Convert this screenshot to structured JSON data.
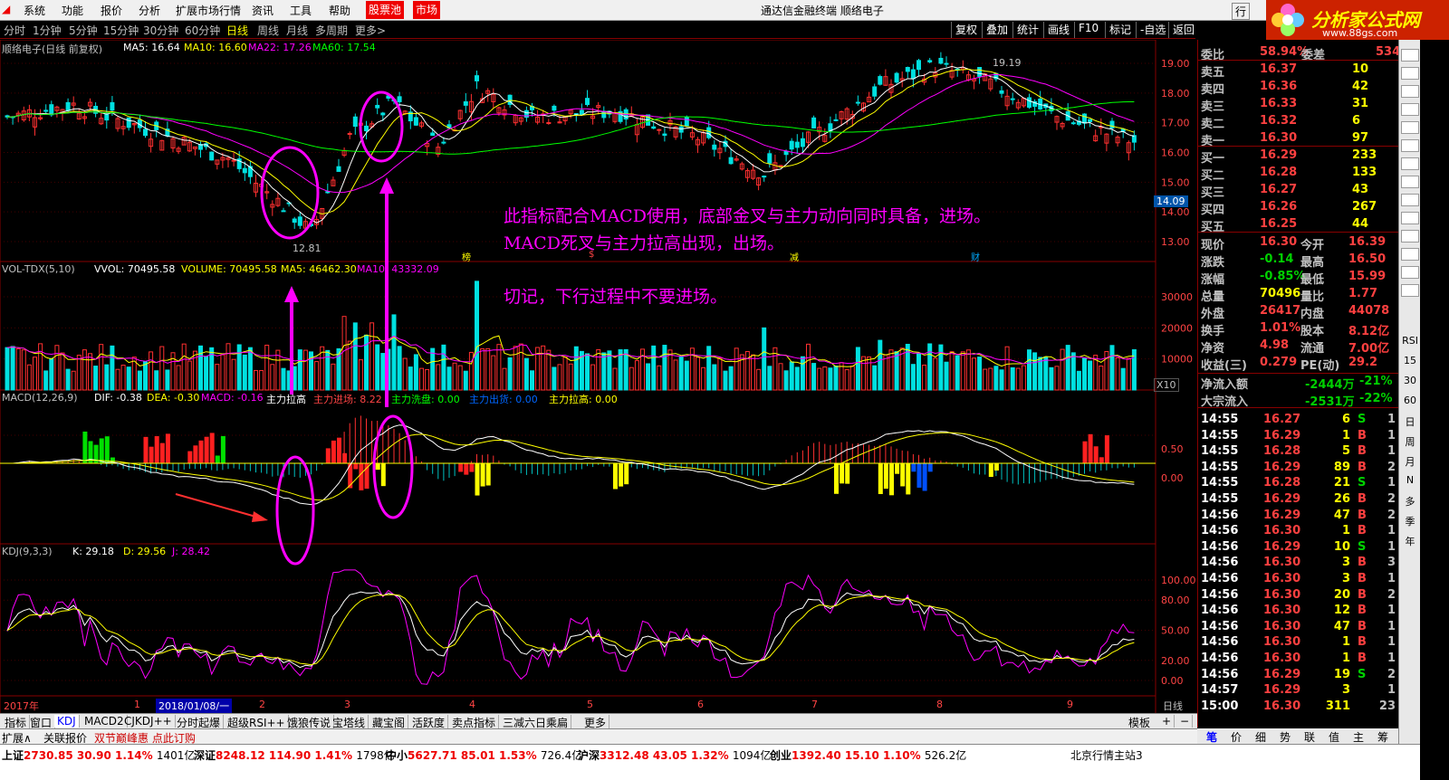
{
  "menu": {
    "items": [
      "系统",
      "功能",
      "报价",
      "分析",
      "扩展市场行情",
      "资讯",
      "工具",
      "帮助"
    ],
    "hot1": "股票池",
    "hot2": "市场",
    "title": "通达信金融终端  顺络电子",
    "logo_text": "分析家公式网",
    "logo_url": "www.88gs.com",
    "right_btn": "行"
  },
  "periods": {
    "items": [
      "分时",
      "1分钟",
      "5分钟",
      "15分钟",
      "30分钟",
      "60分钟",
      "日线",
      "周线",
      "月线",
      "多周期",
      "更多>"
    ],
    "active": "日线",
    "tools": [
      "复权",
      "叠加",
      "统计",
      "画线",
      "F10",
      "标记",
      "-自选",
      "返回"
    ]
  },
  "main_chart": {
    "title": "顺络电子(日线 前复权)",
    "ma": [
      {
        "label": "MA5: 16.64",
        "color": "#ffffff"
      },
      {
        "label": "MA10: 16.60",
        "color": "#ffff00"
      },
      {
        "label": "MA22: 17.26",
        "color": "#ff00ff"
      },
      {
        "label": "MA60: 17.54",
        "color": "#00ff00"
      }
    ],
    "y_ticks": [
      "19.00",
      "18.00",
      "17.00",
      "16.00",
      "15.00",
      "14.00",
      "13.00"
    ],
    "y_values": [
      19,
      18,
      17,
      16,
      15,
      14,
      13
    ],
    "price_tag": "14.09",
    "high_label": "19.19",
    "low_label": "12.81",
    "markers": [
      "榜",
      "$",
      "减",
      "财"
    ],
    "annotation1": "此指标配合MACD使用，底部金叉与主力动向同时具备，进场。",
    "annotation2": "MACD死叉与主力拉高出现，出场。",
    "annotation3": "切记，下行过程中不要进场。"
  },
  "vol_chart": {
    "title": "VOL-TDX(5,10)",
    "vvol": "VVOL: 70495.58",
    "volume": "VOLUME: 70495.58",
    "ma5": "MA5: 46462.30",
    "ma10": "MA10: 43332.09",
    "y_ticks": [
      "30000",
      "20000",
      "10000"
    ],
    "y_values": [
      30000,
      20000,
      10000
    ],
    "x10": "X10"
  },
  "macd_chart": {
    "title": "MACD(12,26,9)",
    "dif": "DIF: -0.38",
    "dea": "DEA: -0.30",
    "macd": "MACD: -0.16",
    "l1": "主力拉高",
    "l2": "主力进场: 8.22",
    "l3": "主力洗盘: 0.00",
    "l4": "主力出货: 0.00",
    "l5": "主力拉高: 0.00",
    "y_ticks": [
      "0.50",
      "0.00"
    ],
    "y_values": [
      0.5,
      0.0
    ]
  },
  "kdj_chart": {
    "title": "KDJ(9,3,3)",
    "k": "K: 29.18",
    "d": "D: 29.56",
    "j": "J: 28.42",
    "y_ticks": [
      "100.00",
      "80.00",
      "50.00",
      "20.00",
      "0.00"
    ],
    "y_values": [
      100,
      80,
      50,
      20,
      0
    ]
  },
  "x_axis": {
    "year": "2017年",
    "date_box": "2018/01/08/一",
    "months": [
      "1",
      "2",
      "3",
      "4",
      "5",
      "6",
      "7",
      "8",
      "9"
    ],
    "period": "日线"
  },
  "quote": {
    "wb": {
      "l": "委比",
      "v": "58.94%",
      "l2": "委差",
      "v2": "534"
    },
    "asks": [
      [
        "卖五",
        "16.37",
        "10"
      ],
      [
        "卖四",
        "16.36",
        "42"
      ],
      [
        "卖三",
        "16.33",
        "31"
      ],
      [
        "卖二",
        "16.32",
        "6"
      ],
      [
        "卖一",
        "16.30",
        "97"
      ]
    ],
    "bids": [
      [
        "买一",
        "16.29",
        "233"
      ],
      [
        "买二",
        "16.28",
        "133"
      ],
      [
        "买三",
        "16.27",
        "43"
      ],
      [
        "买四",
        "16.26",
        "267"
      ],
      [
        "买五",
        "16.25",
        "44"
      ]
    ],
    "stats": [
      [
        "现价",
        "16.30",
        "今开",
        "16.39"
      ],
      [
        "涨跌",
        "-0.14",
        "最高",
        "16.50"
      ],
      [
        "涨幅",
        "-0.85%",
        "最低",
        "15.99"
      ],
      [
        "总量",
        "70496",
        "量比",
        "1.77"
      ],
      [
        "外盘",
        "26417",
        "内盘",
        "44078"
      ],
      [
        "换手",
        "1.01%",
        "股本",
        "8.12亿"
      ],
      [
        "净资",
        "4.98",
        "流通",
        "7.00亿"
      ],
      [
        "收益(三)",
        "0.279",
        "PE(动)",
        "29.2"
      ]
    ],
    "flows": [
      [
        "净流入额",
        "-2444万",
        "-21%"
      ],
      [
        "大宗流入",
        "-2531万",
        "-22%"
      ]
    ]
  },
  "ticks": [
    [
      "14:55",
      "16.27",
      "6",
      "S",
      "1"
    ],
    [
      "14:55",
      "16.29",
      "1",
      "B",
      "1"
    ],
    [
      "14:55",
      "16.28",
      "5",
      "B",
      "1"
    ],
    [
      "14:55",
      "16.29",
      "89",
      "B",
      "2"
    ],
    [
      "14:55",
      "16.28",
      "21",
      "S",
      "1"
    ],
    [
      "14:55",
      "16.29",
      "26",
      "B",
      "2"
    ],
    [
      "14:56",
      "16.29",
      "47",
      "B",
      "2"
    ],
    [
      "14:56",
      "16.30",
      "1",
      "B",
      "1"
    ],
    [
      "14:56",
      "16.29",
      "10",
      "S",
      "1"
    ],
    [
      "14:56",
      "16.30",
      "3",
      "B",
      "3"
    ],
    [
      "14:56",
      "16.30",
      "3",
      "B",
      "1"
    ],
    [
      "14:56",
      "16.30",
      "20",
      "B",
      "2"
    ],
    [
      "14:56",
      "16.30",
      "12",
      "B",
      "1"
    ],
    [
      "14:56",
      "16.30",
      "47",
      "B",
      "1"
    ],
    [
      "14:56",
      "16.30",
      "1",
      "B",
      "1"
    ],
    [
      "14:56",
      "16.30",
      "1",
      "B",
      "1"
    ],
    [
      "14:56",
      "16.29",
      "19",
      "S",
      "2"
    ],
    [
      "14:57",
      "16.29",
      "3",
      "",
      "1"
    ],
    [
      "15:00",
      "16.30",
      "311",
      "",
      "23"
    ]
  ],
  "side_buttons": [
    "RSI",
    "15",
    "30",
    "60",
    "日",
    "周",
    "月",
    "N",
    "多",
    "季",
    "年"
  ],
  "ind_tabs": [
    "指标",
    "窗口",
    "KDJ",
    "MACD2",
    "CJKDJ++",
    "分时起爆",
    "超级RSI++",
    "饿狼传说",
    "宝塔线",
    "藏宝阁",
    "活跃度",
    "卖点指标",
    "三减六日乘扁",
    "更多"
  ],
  "ind_active": "KDJ",
  "ext_tabs": [
    "扩展∧",
    "关联报价",
    "双节巅峰惠 点此订购"
  ],
  "template_label": "模板",
  "rp_tabs": [
    "笔",
    "价",
    "细",
    "势",
    "联",
    "值",
    "主",
    "筹"
  ],
  "status": [
    {
      "name": "上证",
      "price": "2730.85",
      "chg": "30.90",
      "pct": "1.14%",
      "amt": "1401亿"
    },
    {
      "name": "深证",
      "price": "8248.12",
      "chg": "114.90",
      "pct": "1.41%",
      "amt": "1798亿"
    },
    {
      "name": "中小",
      "price": "5627.71",
      "chg": "85.01",
      "pct": "1.53%",
      "amt": "726.4亿"
    },
    {
      "name": "沪深",
      "price": "3312.48",
      "chg": "43.05",
      "pct": "1.32%",
      "amt": "1094亿"
    },
    {
      "name": "创业",
      "price": "1392.40",
      "chg": "15.10",
      "pct": "1.10%",
      "amt": "526.2亿"
    }
  ],
  "server": "北京行情主站3"
}
